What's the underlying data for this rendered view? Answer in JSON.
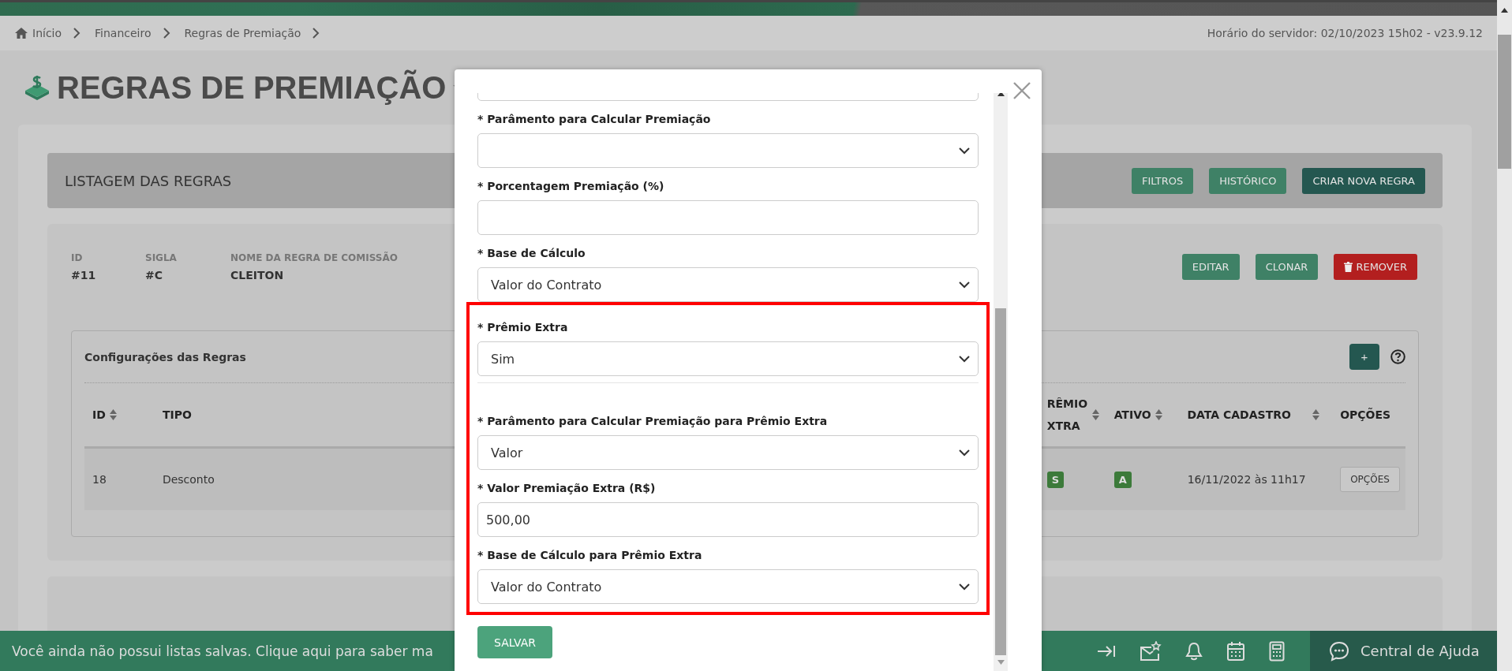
{
  "breadcrumb": [
    {
      "label": "Início",
      "kind": "home"
    },
    {
      "label": "Financeiro",
      "kind": "link"
    },
    {
      "label": "Regras de Premiação",
      "kind": "link"
    }
  ],
  "server_time": "Horário do servidor: 02/10/2023 15h02 - v23.9.12",
  "page_title": "REGRAS DE PREMIAÇÃO",
  "listing": {
    "title": "LISTAGEM DAS REGRAS",
    "buttons": [
      {
        "label": "FILTROS",
        "kind": "normal"
      },
      {
        "label": "HISTÓRICO",
        "kind": "normal"
      },
      {
        "label": "CRIAR NOVA REGRA",
        "kind": "primary"
      }
    ]
  },
  "rule": {
    "fields": [
      {
        "label": "ID",
        "value": "#11"
      },
      {
        "label": "SIGLA",
        "value": "#C"
      },
      {
        "label": "NOME DA REGRA DE COMISSÃO",
        "value": "CLEITON"
      }
    ],
    "actions": [
      {
        "label": "EDITAR",
        "kind": "normal"
      },
      {
        "label": "CLONAR",
        "kind": "normal"
      },
      {
        "label": "REMOVER",
        "kind": "danger"
      }
    ]
  },
  "config": {
    "title": "Configurações das Regras",
    "add_button": "+",
    "columns": [
      {
        "label": "ID",
        "sortable": true
      },
      {
        "label": "TIPO",
        "sortable": false
      },
      {
        "label": "RÊMIO XTRA",
        "sortable": true
      },
      {
        "label": "ATIVO",
        "sortable": true
      },
      {
        "label": "DATA CADASTRO",
        "sortable": true
      },
      {
        "label": "OPÇÕES",
        "sortable": false
      }
    ],
    "rows": [
      {
        "cells": [
          {
            "kind": "text",
            "text": "18"
          },
          {
            "kind": "text",
            "text": "Desconto"
          },
          {
            "kind": "badge",
            "text": "S"
          },
          {
            "kind": "badge",
            "text": "A"
          },
          {
            "kind": "text",
            "text": "16/11/2022 às 11h17"
          },
          {
            "kind": "button",
            "text": "OPÇÕES"
          }
        ]
      }
    ]
  },
  "footer": {
    "message": "Você ainda não possui listas salvas. Clique aqui para saber ma",
    "help": "Central de Ajuda"
  },
  "modal": {
    "groups": [
      {
        "highlighted": false,
        "fields": [
          {
            "label": "* Parâmento para Calcular Premiação",
            "kind": "select"
          },
          {
            "label": "* Porcentagem Premiação (%)",
            "kind": "input"
          },
          {
            "label": "* Base de Cálculo",
            "kind": "select",
            "value": "Valor do Contrato"
          }
        ]
      },
      {
        "highlighted": true,
        "fields": [
          {
            "label": "* Prêmio Extra",
            "kind": "select",
            "value": "Sim"
          },
          {
            "label": "* Parâmento para Calcular Premiação para Prêmio Extra",
            "kind": "select",
            "value": "Valor"
          },
          {
            "label": "* Valor Premiação Extra (R$)",
            "kind": "input",
            "value": "500,00"
          },
          {
            "label": "* Base de Cálculo para Prêmio Extra",
            "kind": "select",
            "value": "Valor do Contrato"
          }
        ]
      }
    ],
    "save": "SALVAR"
  }
}
